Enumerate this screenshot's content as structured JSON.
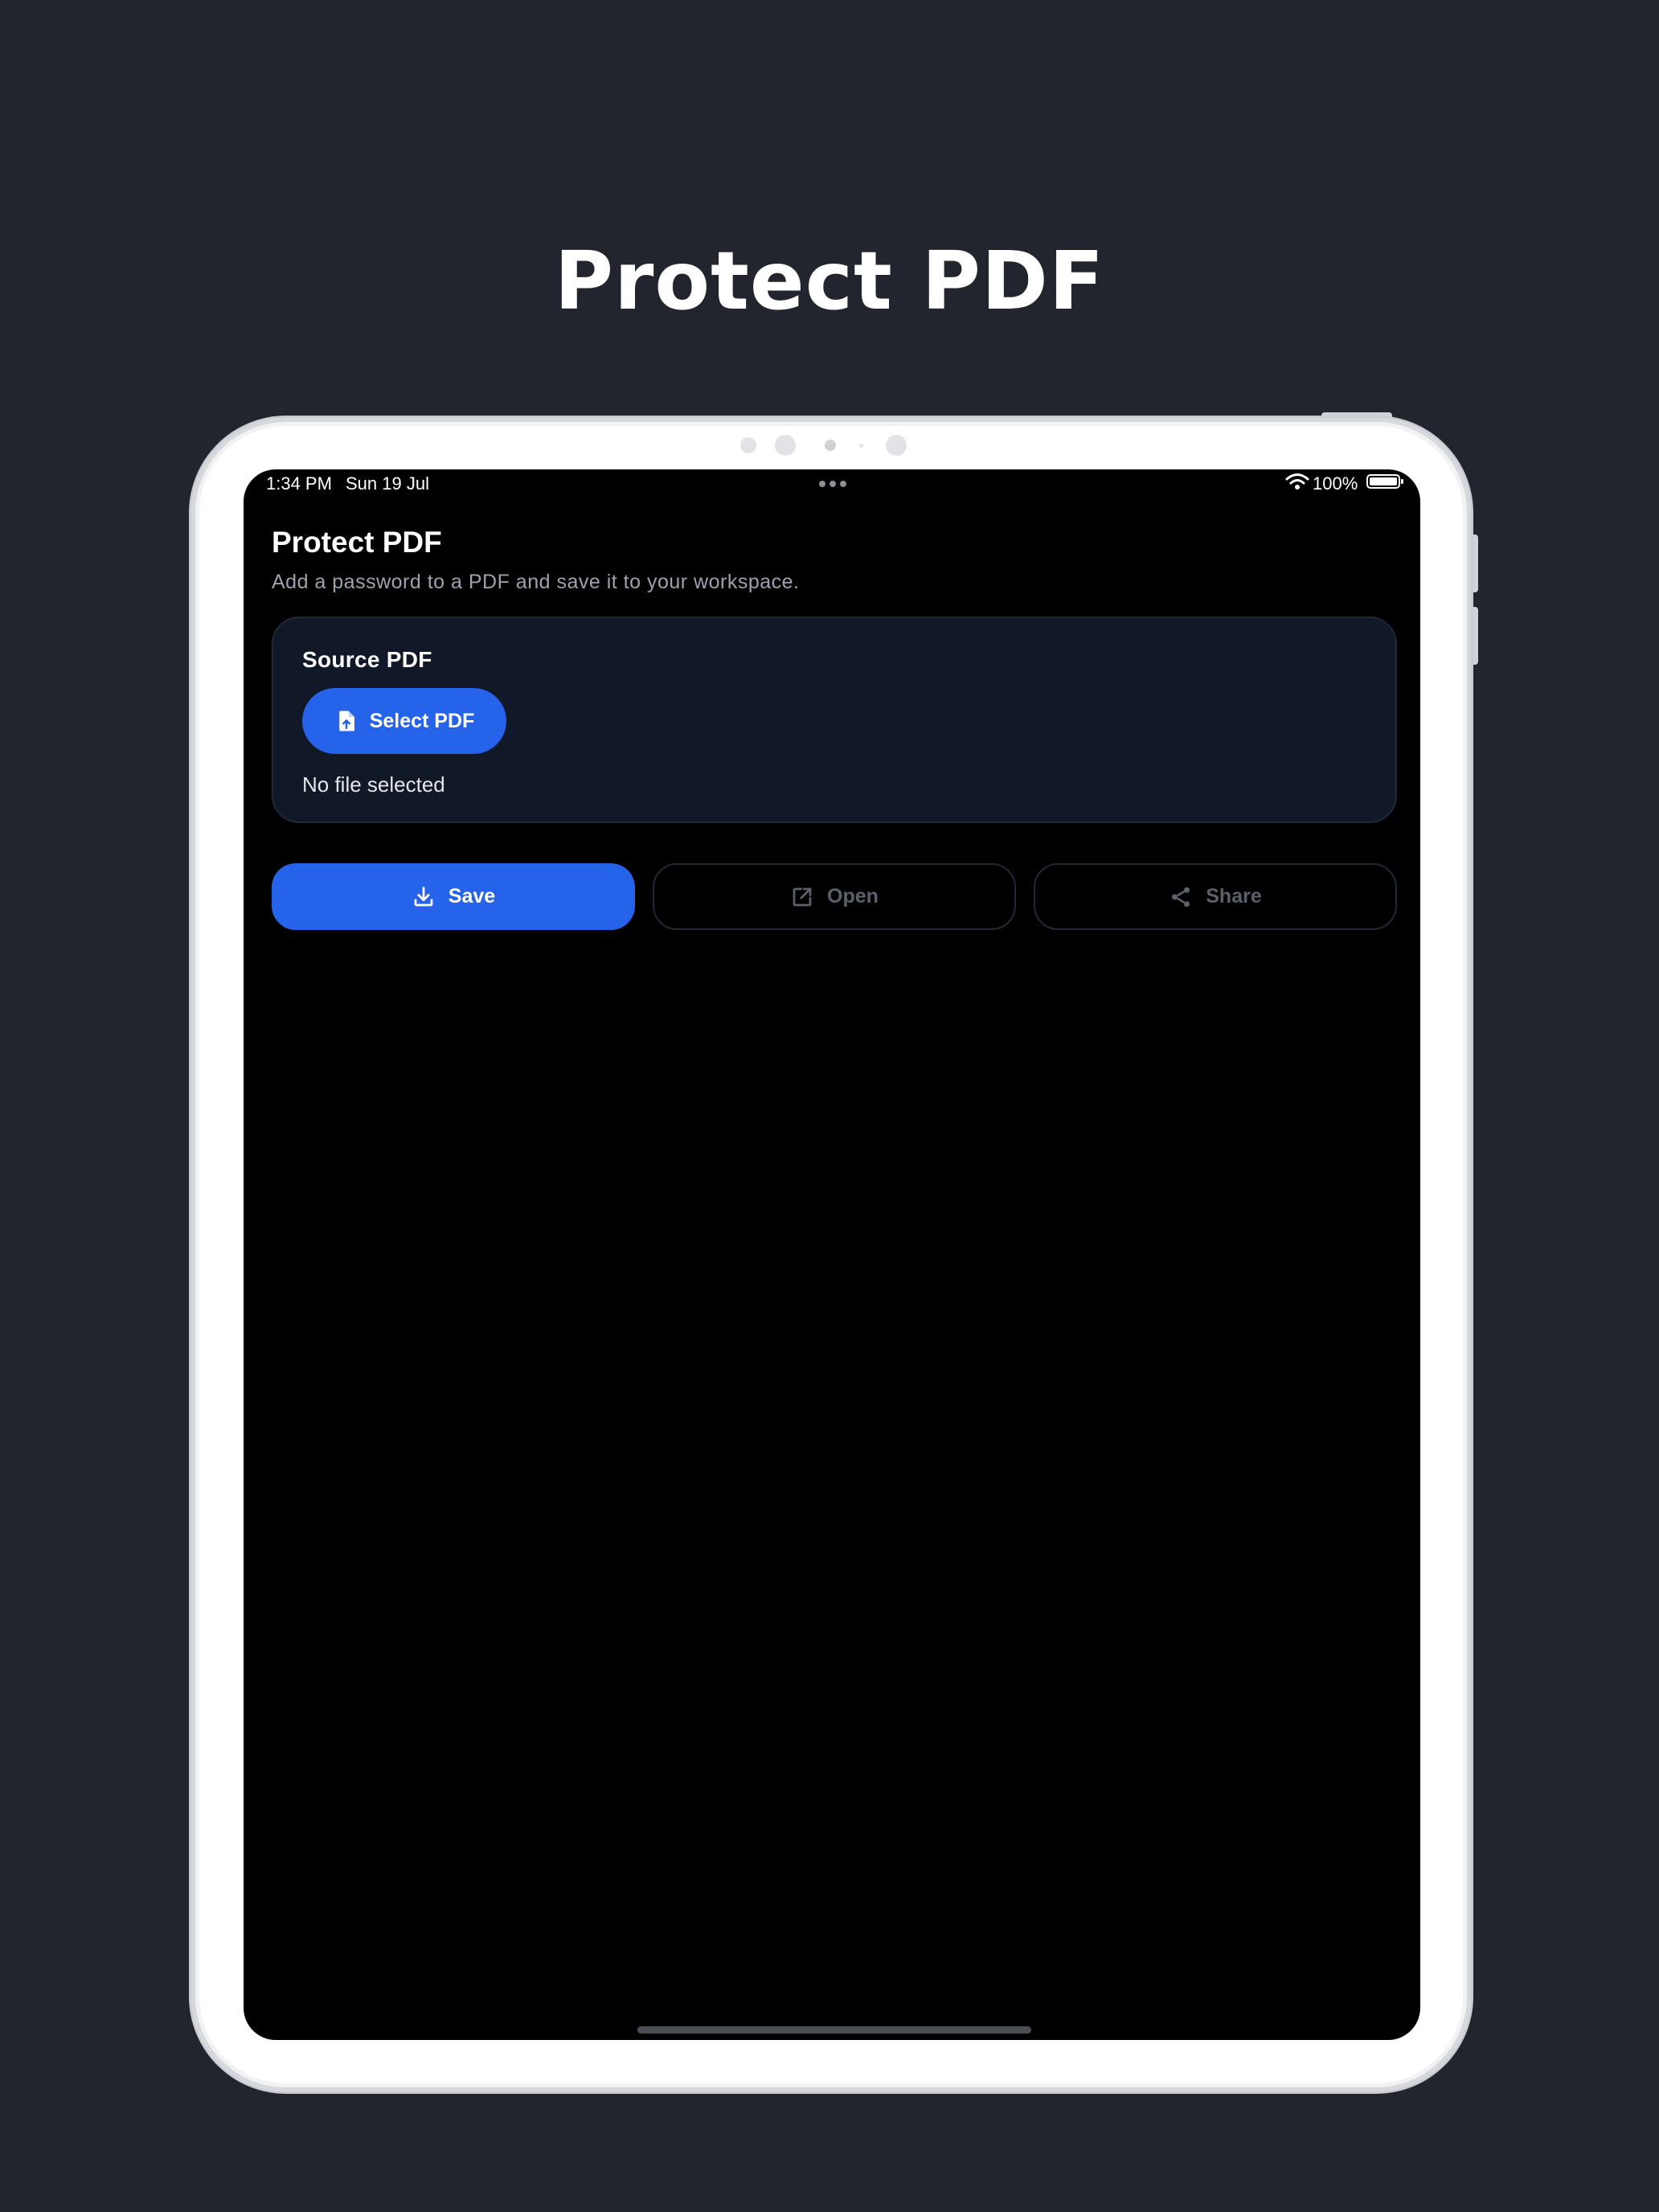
{
  "promo": {
    "title": "Protect PDF"
  },
  "status_bar": {
    "time": "1:34 PM",
    "date": "Sun 19 Jul",
    "battery": "100%",
    "icons": [
      "wifi-icon",
      "battery-icon",
      "multitasking-dots-icon"
    ]
  },
  "page": {
    "title": "Protect PDF",
    "subtitle": "Add a password to a PDF and save it to your workspace."
  },
  "source_card": {
    "title": "Source PDF",
    "select_label": "Select PDF",
    "select_icon": "file-upload-icon",
    "file_status": "No file selected"
  },
  "actions": {
    "save_label": "Save",
    "save_icon": "download-icon",
    "open_label": "Open",
    "open_icon": "external-link-icon",
    "share_label": "Share",
    "share_icon": "share-icon"
  },
  "colors": {
    "background": "#22252d",
    "accent": "#2563eb",
    "card": "#111827",
    "screen": "#000000",
    "disabled_text": "#5b616b"
  }
}
